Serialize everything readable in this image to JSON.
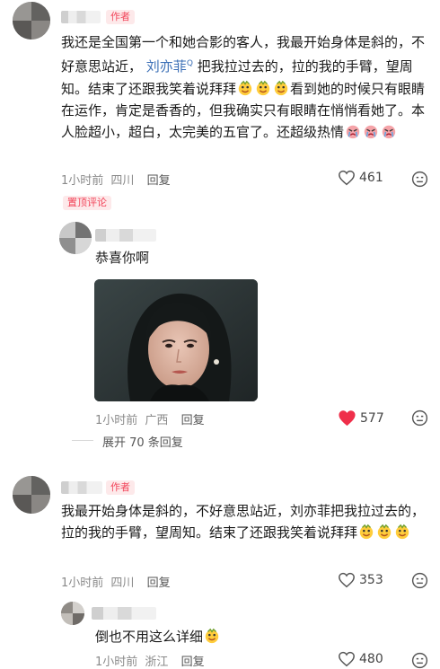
{
  "comments": [
    {
      "tag": "作者",
      "text_a": "我还是全国第一个和她合影的客人，我最开始身体是斜的，不好意思站近，",
      "mention": "刘亦菲",
      "text_b": "把我拉过去的，拉的我的手臂，望周知。结束了还跟我笑着说拜拜",
      "text_c": "看到她的时候只有眼睛在运作，肯定是香香的，但我确实只有眼睛在悄悄看她了。本人脸超小，超白，太完美的五官了。还超级热情",
      "time": "1小时前",
      "location": "四川",
      "reply": "回复",
      "likes": "461"
    },
    {
      "pinned": "置顶评论",
      "text": "恭喜你啊",
      "time": "1小时前",
      "location": "广西",
      "reply": "回复",
      "likes": "577",
      "expand": "展开 70 条回复"
    },
    {
      "tag": "作者",
      "text": "我最开始身体是斜的，不好意思站近，刘亦菲把我拉过去的，拉的我的手臂，望周知。结束了还跟我笑着说拜拜",
      "time": "1小时前",
      "location": "四川",
      "reply": "回复",
      "likes": "353"
    },
    {
      "text": "倒也不用这么详细",
      "time": "1小时前",
      "location": "浙江",
      "reply": "回复",
      "likes": "480"
    }
  ],
  "icons": {
    "heart": "heart-outline-icon",
    "heart_liked": "heart-filled-icon",
    "dislike": "dislike-face-icon",
    "emoji_smile": "smile-emoji",
    "emoji_cry": "cry-emoji"
  },
  "colors": {
    "accent": "#f2465b",
    "liked": "#ef2f4a",
    "mention": "#3b6fb6"
  }
}
